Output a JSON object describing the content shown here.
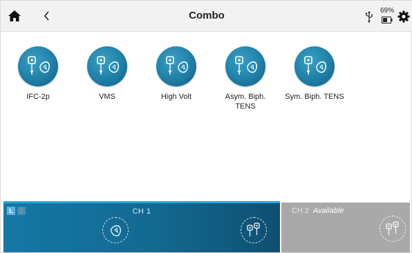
{
  "header": {
    "title": "Combo",
    "battery_percent": "69%"
  },
  "programs": [
    {
      "label": "IFC-2p"
    },
    {
      "label": "VMS"
    },
    {
      "label": "High Volt"
    },
    {
      "label": "Asym. Biph. TENS"
    },
    {
      "label": "Sym. Biph. TENS"
    }
  ],
  "channels": {
    "ch1": {
      "label": "CH 1",
      "badge_left": "L",
      "badge_right": "2"
    },
    "ch2": {
      "label": "CH 2",
      "status": "Available"
    }
  },
  "colors": {
    "accent": "#1f7fa6",
    "ch1_background": "#136990",
    "ch2_background": "#a9a9a9"
  },
  "icons": {
    "home": "home-icon",
    "back": "chevron-left-icon",
    "usb": "usb-icon",
    "battery": "battery-icon",
    "settings": "gear-icon",
    "program": "electrode-pads-icon"
  }
}
